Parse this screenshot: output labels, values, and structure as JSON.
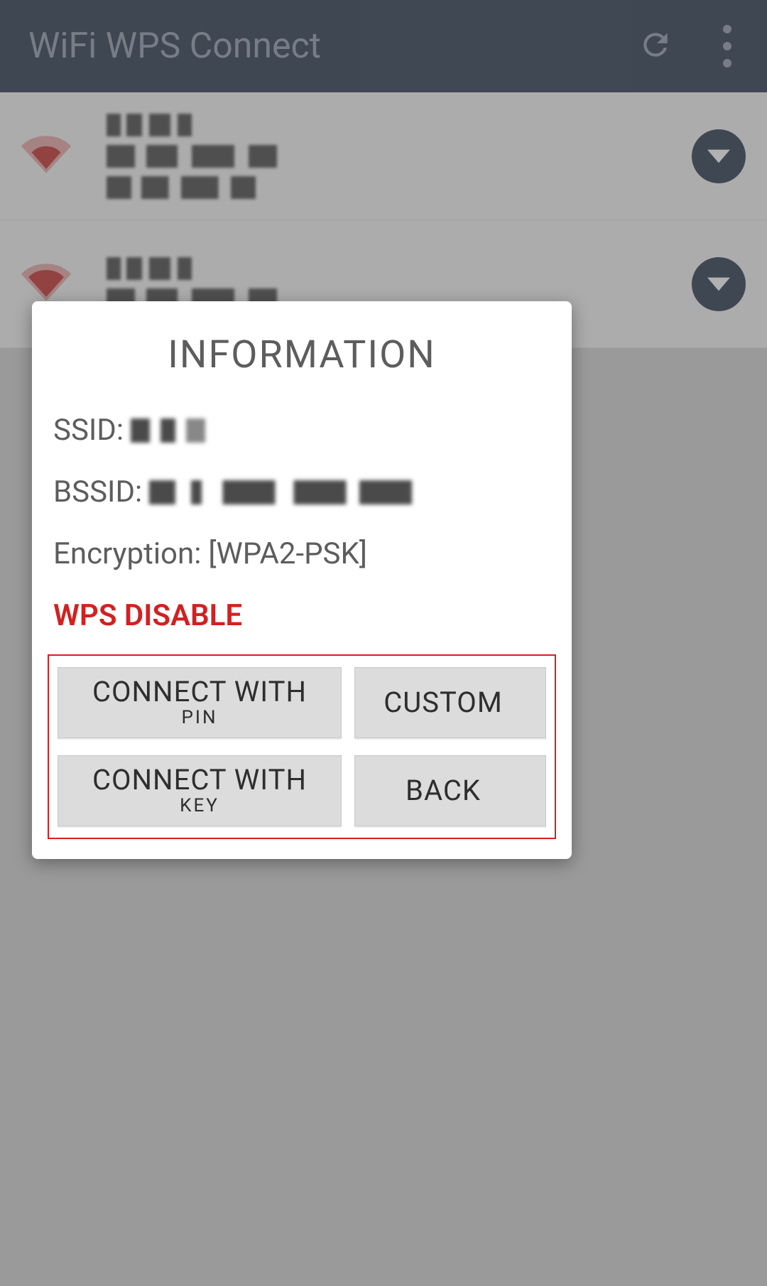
{
  "header": {
    "title": "WiFi WPS Connect"
  },
  "dialog": {
    "title": "INFORMATION",
    "ssid_label": "SSID:",
    "bssid_label": "BSSID:",
    "encryption_label": "Encryption:",
    "encryption_value": "[WPA2-PSK]",
    "wps_status": "WPS DISABLE",
    "buttons": {
      "connect_pin_line1": "CONNECT WITH",
      "connect_pin_line2": "PIN",
      "custom": "CUSTOM",
      "connect_key_line1": "CONNECT WITH",
      "connect_key_line2": "KEY",
      "back": "BACK"
    }
  }
}
